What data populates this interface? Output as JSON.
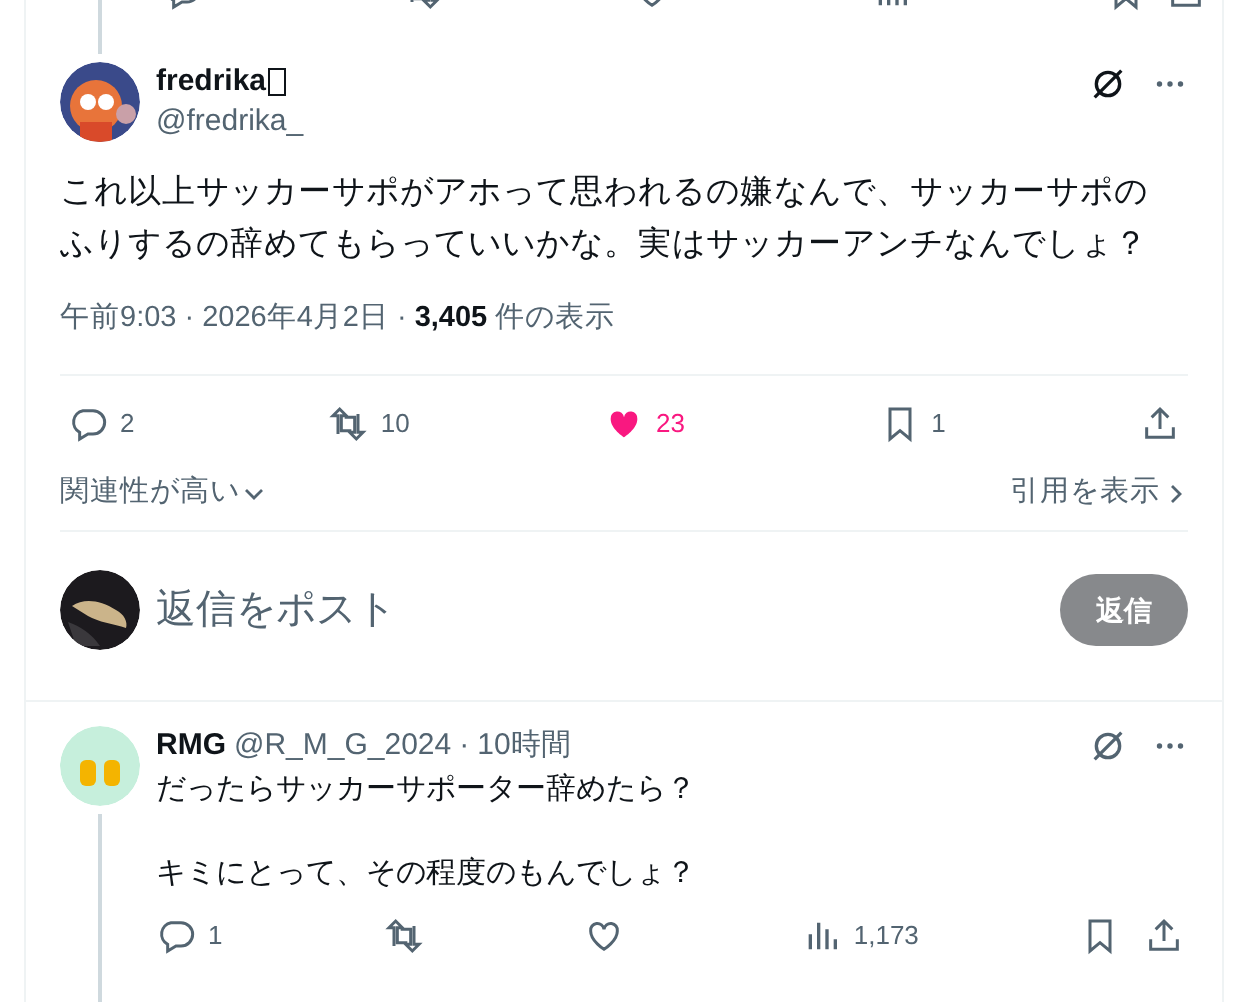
{
  "main_post": {
    "display_name": "fredrika",
    "name_has_missing_glyph": true,
    "handle": "@fredrika_",
    "text": "これ以上サッカーサポがアホって思われるの嫌なんで、サッカーサポのふりするの辞めてもらっていいかな。実はサッカーアンチなんでしょ？",
    "time": "午前9:03",
    "separator": "·",
    "separator_2": "·",
    "date": "2026年4月2日",
    "views": "3,405",
    "views_label": "件の表示",
    "replies": "2",
    "reposts": "10",
    "likes": "23",
    "liked": true,
    "bookmarks": "1"
  },
  "sort": {
    "label": "関連性が高い"
  },
  "quotes_link": "引用を表示",
  "compose": {
    "placeholder": "返信をポスト",
    "button": "返信"
  },
  "replies": [
    {
      "display_name": "RMG",
      "handle": "@R_M_G_2024",
      "separator": "·",
      "time": "10時間",
      "paragraphs": [
        "だったらサッカーサポーター辞めたら？",
        "キミにとって、その程度のもんでしょ？"
      ],
      "replies": "1",
      "liked": false,
      "views": "1,173"
    }
  ]
}
